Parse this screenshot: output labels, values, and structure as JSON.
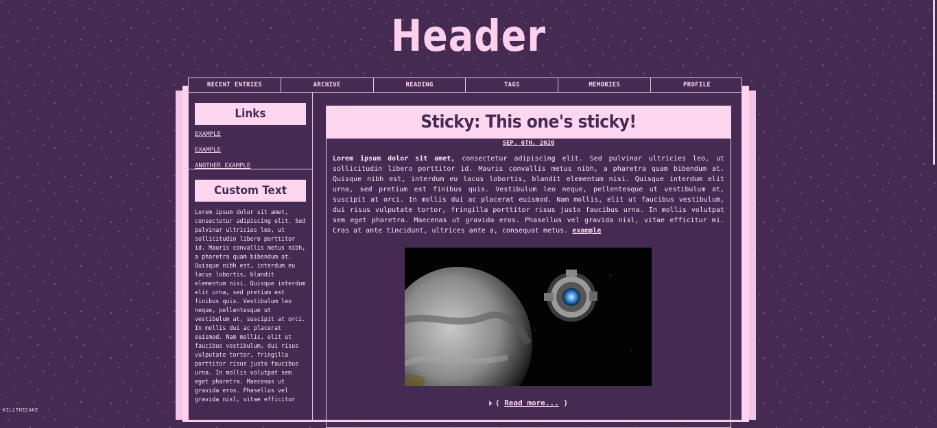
{
  "header": {
    "title": "Header"
  },
  "nav": {
    "items": [
      "RECENT ENTRIES",
      "ARCHIVE",
      "READING",
      "TAGS",
      "MEMORIES",
      "PROFILE"
    ]
  },
  "sidebar": {
    "links_heading": "Links",
    "links": [
      "EXAMPLE",
      "EXAMPLE",
      "ANOTHER EXAMPLE"
    ],
    "custom_heading": "Custom Text",
    "custom_text": "Lorem ipsum dolor sit amet, consectetur adipiscing elit. Sed pulvinar ultricies leo, ut sollicitudin libero porttitor id. Mauris convallis metus nibh, a pharetra quam bibendum at. Quisque nibh est, interdum eu lacus lobortis, blandit elementum nisi. Quisque interdum elit urna, sed pretium est finibus quis. Vestibulum leo neque, pellentesque ut vestibulum at, suscipit at orci. In mollis dui ac placerat euismod. Nam mollis, elit ut faucibus vestibulum, dui risus vulputate tortor, fringilla porttitor risus justo faucibus urna. In mollis volutpat sem eget pharetra. Maecenas ut gravida eros. Phasellus vel gravida nisl, vitae efficitur"
  },
  "entry": {
    "title": "Sticky: This one's sticky!",
    "date": "SEP. 6TH, 2020",
    "lead": "Lorem ipsum dolor sit amet,",
    "body": " consectetur adipiscing elit. Sed pulvinar ultricies leo, ut sollicitudin libero porttitor id. Mauris convallis metus nibh, a pharetra quam bibendum at. Quisque nibh est, interdum eu lacus lobortis, blandit elementum nisi. Quisque interdum elit urna, sed pretium est finibus quis. Vestibulum leo neque, pellentesque ut vestibulum at, suscipit at orci. In mollis dui ac placerat euismod. Nam mollis, elit ut faucibus vestibulum, dui risus vulputate tortor, fringilla porttitor risus justo faucibus urna. In mollis volutpat sem eget pharetra. Maecenas ut gravida eros. Phasellus vel gravida nisl, vitae efficitur mi. Cras at ante tincidunt, ultrices ante a, consequat metus. ",
    "link": "example",
    "read_more_open": "( ",
    "read_more": "Read more...",
    "read_more_close": " )"
  },
  "footer": {
    "watermark": "KILLTHECAKE"
  },
  "colors": {
    "background": "#452b52",
    "accent": "#ffd6f0",
    "border": "#e9c8e3"
  }
}
